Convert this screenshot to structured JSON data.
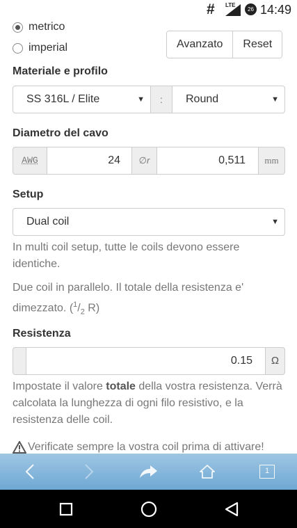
{
  "status": {
    "notif_icon": "hash",
    "network": "LTE",
    "battery_level": "26",
    "time": "14:49"
  },
  "units": {
    "metric_label": "metrico",
    "imperial_label": "imperial",
    "selected": "metrico"
  },
  "buttons": {
    "advanced": "Avanzato",
    "reset": "Reset"
  },
  "material": {
    "label": "Materiale e profilo",
    "material_value": "SS 316L / Elite",
    "separator": ":",
    "profile_value": "Round"
  },
  "wire": {
    "label": "Diametro del cavo",
    "awg_label": "AWG",
    "awg_value": "24",
    "diameter_symbol": "∅r",
    "diameter_value": "0,511",
    "unit": "mm"
  },
  "setup": {
    "label": "Setup",
    "value": "Dual coil",
    "note1": "In multi coil setup, tutte le coils devono essere identiche.",
    "note2_text": "Due coil in parallelo. Il totale della resistenza e' dimezzato. (",
    "note2_num": "1",
    "note2_slash": "/",
    "note2_den": "2",
    "note2_end": " R)"
  },
  "resistance": {
    "label": "Resistenza",
    "value": "0.15",
    "unit": "Ω",
    "help_a": "Impostate il valore ",
    "help_bold": "totale",
    "help_b": " della vostra resistenza. Verrà calcolata la lunghezza di ogni filo resistivo, e la resistenza delle coil."
  },
  "warning": {
    "text": "Verificate sempre la vostra coil prima di attivare!",
    "icon": "warning-triangle-icon"
  },
  "browser_toolbar": {
    "tab_count": "1"
  },
  "colors": {
    "toolbar_top": "#9ec6e3",
    "toolbar_bottom": "#6fa8d4",
    "navbar": "#000000"
  }
}
